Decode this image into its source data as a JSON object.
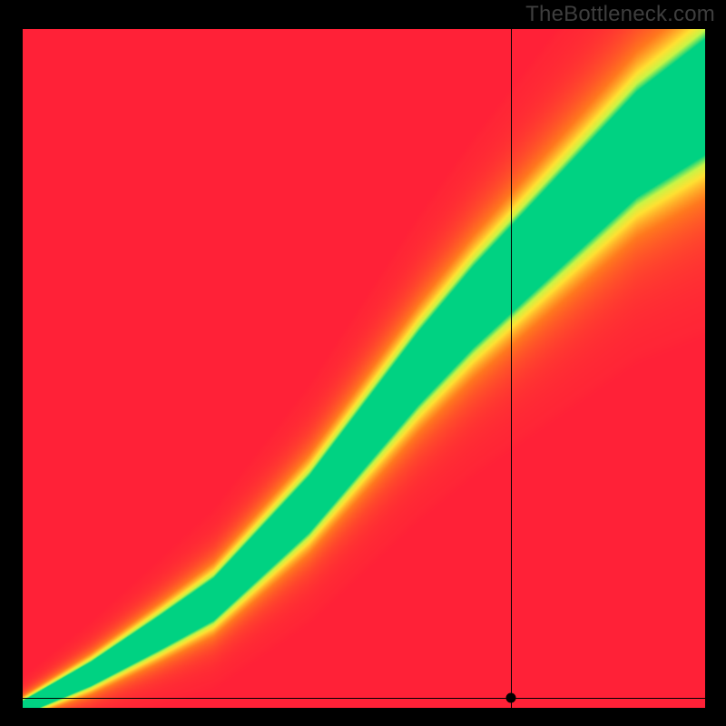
{
  "watermark": "TheBottleneck.com",
  "chart_data": {
    "type": "heatmap",
    "title": "",
    "xlabel": "",
    "ylabel": "",
    "xlim": [
      0,
      1
    ],
    "ylim": [
      0,
      1
    ],
    "x_ticks": [],
    "y_ticks": [],
    "colorscale_note": "value 0 = far from ideal (red), 1 = ideal match (green); intermediate through orange/yellow",
    "ridge": {
      "description": "center of the green optimal band as (x, y) fractions of plot area, origin bottom-left",
      "points": [
        [
          0.0,
          0.0
        ],
        [
          0.1,
          0.05
        ],
        [
          0.2,
          0.11
        ],
        [
          0.28,
          0.16
        ],
        [
          0.35,
          0.23
        ],
        [
          0.42,
          0.3
        ],
        [
          0.5,
          0.4
        ],
        [
          0.58,
          0.5
        ],
        [
          0.66,
          0.59
        ],
        [
          0.74,
          0.67
        ],
        [
          0.82,
          0.75
        ],
        [
          0.9,
          0.83
        ],
        [
          1.0,
          0.9
        ]
      ],
      "band_halfwidth_start": 0.01,
      "band_halfwidth_end": 0.085
    },
    "marker": {
      "x": 0.715,
      "y": 0.015
    },
    "crosshair": {
      "vertical_x": 0.715,
      "horizontal_y": 0.015
    },
    "background_border_color": "#000000",
    "watermark_color": "#3e3e3e"
  }
}
